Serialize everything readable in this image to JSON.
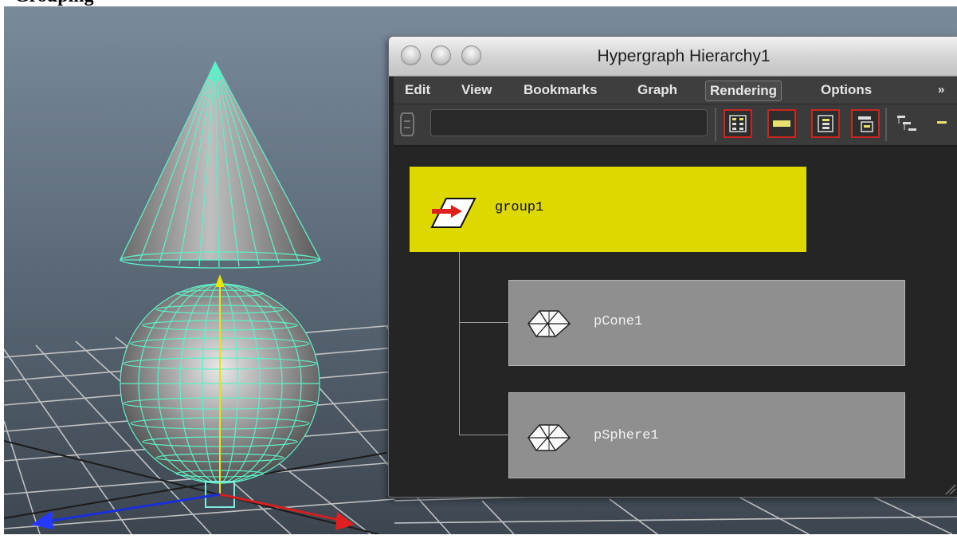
{
  "page": {
    "heading": "Grouping"
  },
  "viewport": {
    "icons": [
      "cone-wireframe",
      "sphere-wireframe",
      "translate-manipulator",
      "ground-grid"
    ],
    "colors": {
      "background_top": "#6f7f8f",
      "background_bottom": "#4a5561",
      "wireframe": "#5ef0c8",
      "grid": "#d0d0d0"
    }
  },
  "hypergraph": {
    "title": "Hypergraph Hierarchy1",
    "menu": {
      "items": [
        {
          "label": "Edit"
        },
        {
          "label": "View"
        },
        {
          "label": "Bookmarks"
        },
        {
          "label": "Graph"
        },
        {
          "label": "Rendering",
          "active": true
        },
        {
          "label": "Options"
        }
      ],
      "overflow": "»"
    },
    "toolbar": {
      "field_value": "",
      "buttons": [
        "scene-hierarchy-icon",
        "input-output-icon",
        "expand-icon",
        "collapse-icon",
        "layout-icon"
      ]
    },
    "nodes": {
      "group": {
        "label": "group1",
        "icon": "transform-group-icon"
      },
      "children": [
        {
          "label": "pCone1",
          "icon": "mesh-icon"
        },
        {
          "label": "pSphere1",
          "icon": "mesh-icon"
        }
      ]
    },
    "colors": {
      "group_node": "#dcd800",
      "child_node": "#8f8f8f",
      "graph_bg": "#252525",
      "accent": "#c8261f"
    }
  }
}
